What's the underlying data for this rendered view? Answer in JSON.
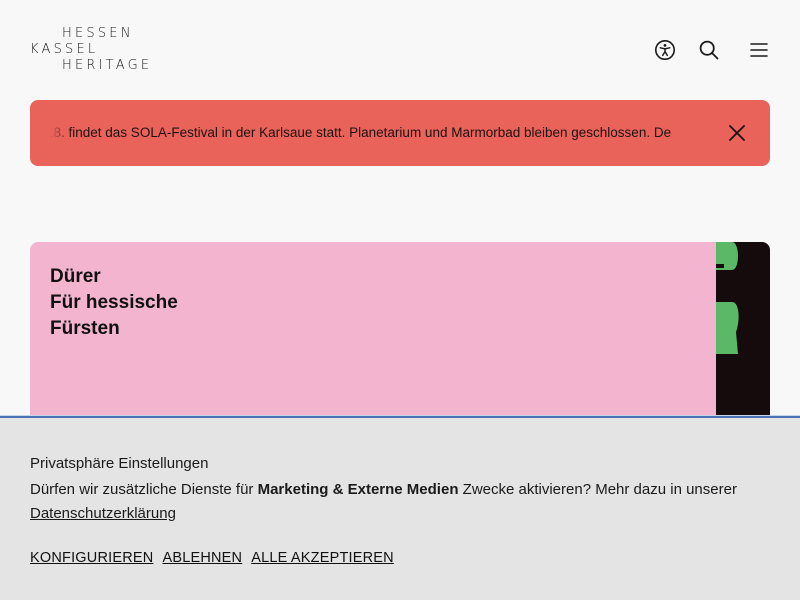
{
  "logo": {
    "line1": "HESSEN",
    "line2": "KASSEL",
    "line3": "HERITAGE"
  },
  "header": {
    "icons": [
      "accessibility-icon",
      "search-icon",
      "menu-icon"
    ]
  },
  "notice": {
    "text": "18. findet das SOLA-Festival in der Karlsaue statt. Planetarium und Marmorbad bleiben geschlossen. De",
    "background": "#e9635a",
    "close_icon": "close-icon"
  },
  "feature": {
    "title_lines": [
      "Dürer",
      "Für hessische",
      "Fürsten"
    ],
    "background": "#f3b4cf",
    "image_accent": "#5bb866"
  },
  "consent": {
    "title": "Privatsphäre Einstellungen",
    "text_before": "Dürfen wir zusätzliche Dienste für ",
    "text_bold": "Marketing & Externe Medien",
    "text_after": " Zwecke aktivieren? Mehr dazu in unserer ",
    "link": "Datenschutzerklärung",
    "buttons": {
      "configure": "KONFIGURIEREN",
      "decline": "ABLEHNEN",
      "accept_all": "ALLE AKZEPTIEREN"
    },
    "accent": "#4a73b5"
  }
}
